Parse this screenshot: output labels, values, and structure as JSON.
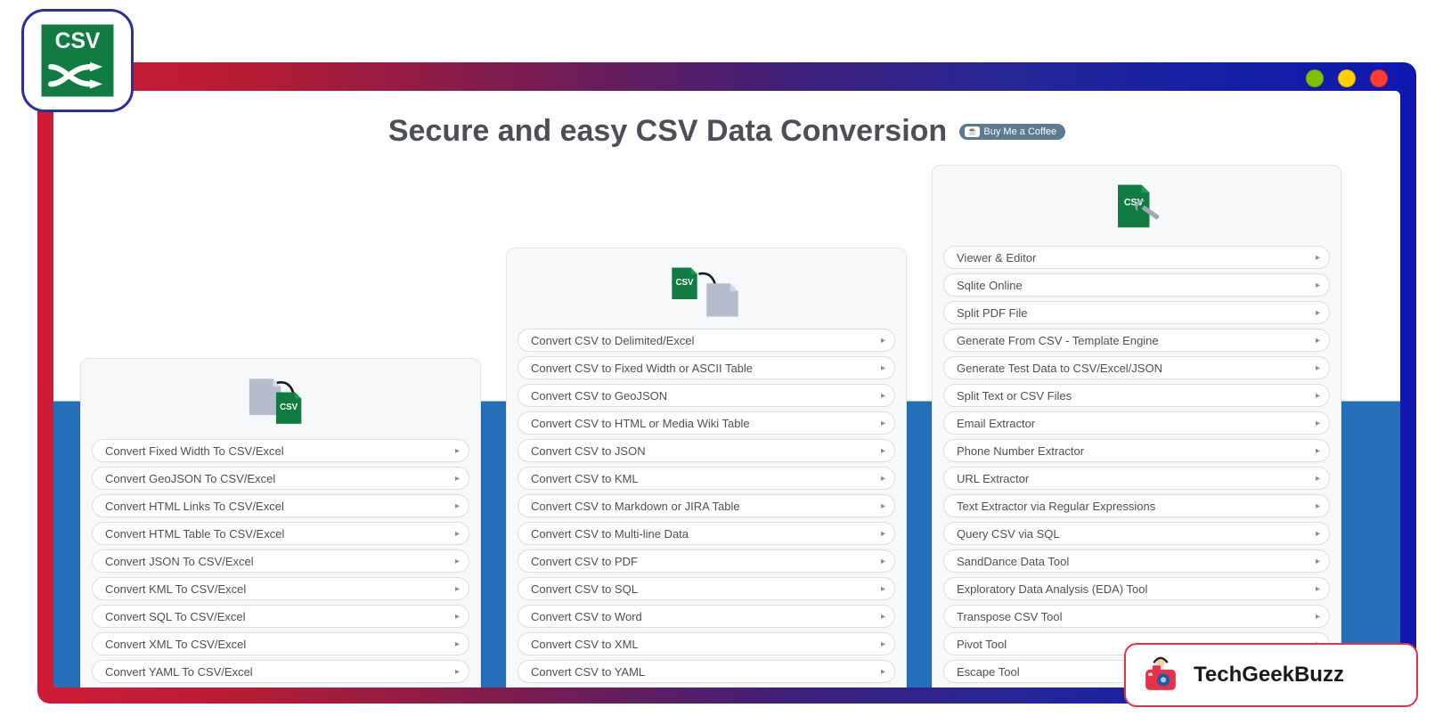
{
  "header": {
    "title": "Secure and easy CSV Data Conversion",
    "buy_me_coffee": "Buy Me a Coffee"
  },
  "panels": {
    "to_csv": {
      "items": [
        "Convert Fixed Width To CSV/Excel",
        "Convert GeoJSON To CSV/Excel",
        "Convert HTML Links To CSV/Excel",
        "Convert HTML Table To CSV/Excel",
        "Convert JSON To CSV/Excel",
        "Convert KML To CSV/Excel",
        "Convert SQL To CSV/Excel",
        "Convert XML To CSV/Excel",
        "Convert YAML To CSV/Excel"
      ]
    },
    "from_csv": {
      "items": [
        "Convert CSV to Delimited/Excel",
        "Convert CSV to Fixed Width or ASCII Table",
        "Convert CSV to GeoJSON",
        "Convert CSV to HTML or Media Wiki Table",
        "Convert CSV to JSON",
        "Convert CSV to KML",
        "Convert CSV to Markdown or JIRA Table",
        "Convert CSV to Multi-line Data",
        "Convert CSV to PDF",
        "Convert CSV to SQL",
        "Convert CSV to Word",
        "Convert CSV to XML",
        "Convert CSV to YAML"
      ]
    },
    "tools": {
      "items": [
        "Viewer & Editor",
        "Sqlite Online",
        "Split PDF File",
        "Generate From CSV - Template Engine",
        "Generate Test Data to CSV/Excel/JSON",
        "Split Text or CSV Files",
        "Email Extractor",
        "Phone Number Extractor",
        "URL Extractor",
        "Text Extractor via Regular Expressions",
        "Query CSV via SQL",
        "SandDance Data Tool",
        "Exploratory Data Analysis (EDA) Tool",
        "Transpose CSV Tool",
        "Pivot Tool",
        "Escape Tool"
      ]
    }
  },
  "brand": {
    "csv_logo_label": "CSV",
    "techgeekbuzz": "TechGeekBuzz"
  }
}
